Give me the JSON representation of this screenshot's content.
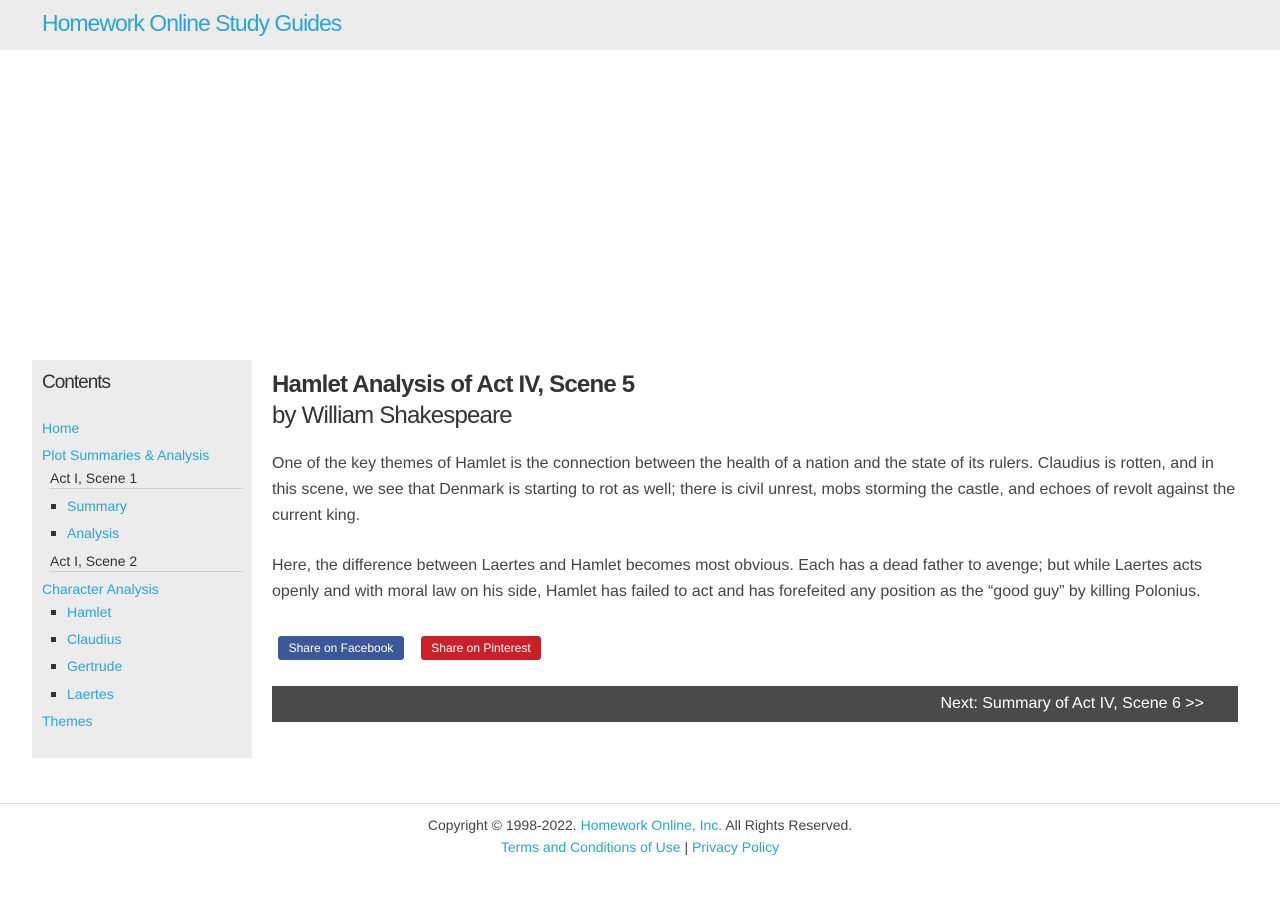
{
  "header": {
    "site_title": "Homework Online Study Guides"
  },
  "sidebar": {
    "title": "Contents",
    "home": "Home",
    "plot_section": "Plot Summaries & Analysis",
    "act1_scene1": "Act I, Scene 1",
    "summary": "Summary",
    "analysis": "Analysis",
    "act1_scene2": "Act I, Scene 2",
    "character_section": "Character Analysis",
    "characters": [
      "Hamlet",
      "Claudius",
      "Gertrude",
      "Laertes"
    ],
    "themes": "Themes"
  },
  "article": {
    "title": "Hamlet Analysis of Act IV, Scene 5",
    "author": "by William Shakespeare",
    "paragraphs": [
      "One of the key themes of Hamlet is the connection between the health of a nation and the state of its rulers. Claudius is rotten, and in this scene, we see that Denmark is starting to rot as well; there is civil unrest, mobs storming the castle, and echoes of revolt against the current king.",
      "Here, the difference between Laertes and Hamlet becomes most obvious. Each has a dead father to avenge; but while Laertes acts openly and with moral law on his side, Hamlet has failed to act and has forefeited any position as the “good guy” by killing Polonius."
    ],
    "share_facebook": "Share on Facebook",
    "share_pinterest": "Share on Pinterest",
    "next_link": "Next: Summary of Act IV, Scene 6 >>"
  },
  "footer": {
    "copyright": "Copyright © 1998-2022.",
    "company": "Homework Online, Inc.",
    "rights": "All Rights Reserved.",
    "terms": "Terms and Conditions of Use",
    "separator": "|",
    "privacy": "Privacy Policy"
  },
  "colors": {
    "link": "#2aa5d8",
    "topbar": "#ececec",
    "facebook": "#3b5998",
    "pinterest": "#cb2027",
    "next_bar": "#4a4a4a"
  }
}
